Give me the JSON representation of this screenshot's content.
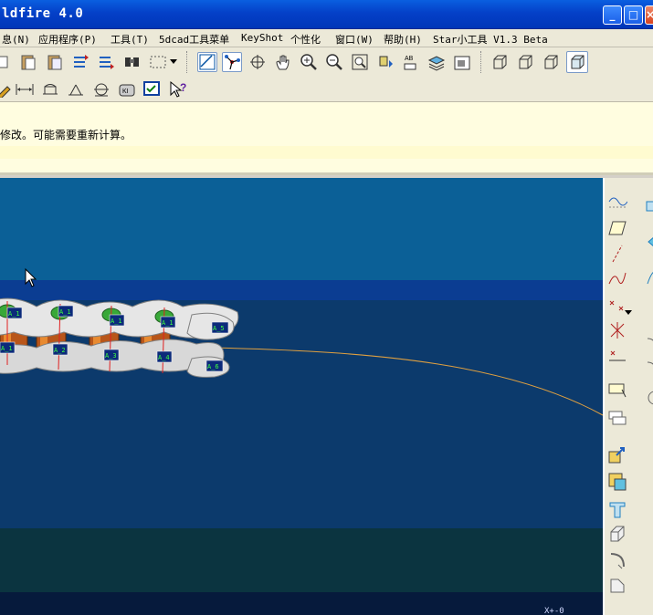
{
  "window": {
    "title": "ldfire 4.0",
    "controls": [
      "_",
      "□",
      "×"
    ]
  },
  "menu": [
    {
      "label": "息(N)"
    },
    {
      "label": "应用程序(P)"
    },
    {
      "label": "工具(T)"
    },
    {
      "label": "5dcad工具菜单"
    },
    {
      "label": "KeyShot"
    },
    {
      "label": "个性化"
    },
    {
      "label": "窗口(W)"
    },
    {
      "label": "帮助(H)"
    },
    {
      "label": "Star小工具 V1.3 Beta"
    }
  ],
  "message": {
    "line": "修改。可能需要重新计算。"
  },
  "datum_labels": [
    "A_1",
    "A_1",
    "A_1",
    "A_1",
    "A_1",
    "A_2",
    "A_3",
    "A_4",
    "A_5",
    "A_6"
  ],
  "status": {
    "coord": "X+-0"
  },
  "colors": {
    "titlebar": "#0440c8",
    "menubar": "#ece9d8",
    "message_bg": "#fffde0",
    "viewport_top": "#0b6097",
    "viewport_mid": "#0c3a6c",
    "curve": "#e0a040"
  }
}
